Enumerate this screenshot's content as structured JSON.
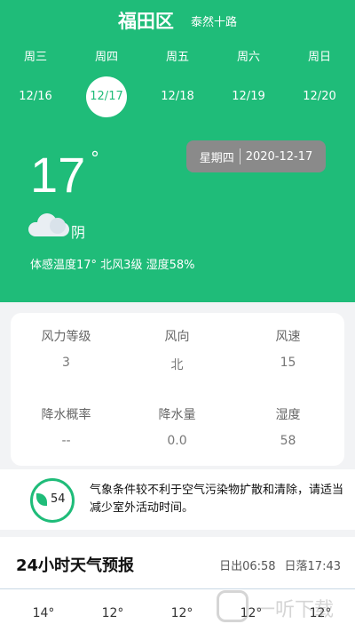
{
  "header": {
    "city": "福田区",
    "district": "泰然十路"
  },
  "days": [
    {
      "weekday": "周三",
      "date": "12/16"
    },
    {
      "weekday": "周四",
      "date": "12/17"
    },
    {
      "weekday": "周五",
      "date": "12/18"
    },
    {
      "weekday": "周六",
      "date": "12/19"
    },
    {
      "weekday": "周日",
      "date": "12/20"
    }
  ],
  "selected_day_index": 1,
  "current": {
    "weekday": "星期四",
    "date": "2020-12-17",
    "temperature": "17",
    "degree_symbol": "°",
    "condition": "阴",
    "condition_icon": "cloud-icon",
    "feels_line": "体感温度17°  北风3级  湿度58%"
  },
  "details": [
    {
      "label": "风力等级",
      "value": "3"
    },
    {
      "label": "风向",
      "value": "北"
    },
    {
      "label": "风速",
      "value": "15"
    },
    {
      "label": "降水概率",
      "value": "--"
    },
    {
      "label": "降水量",
      "value": "0.0"
    },
    {
      "label": "湿度",
      "value": "58"
    }
  ],
  "aqi": {
    "value": "54",
    "text": "气象条件较不利于空气污染物扩散和清除，请适当减少室外活动时间。",
    "color": "#1fbc79"
  },
  "forecast": {
    "title": "24小时天气预报",
    "sunrise": "日出06:58",
    "sunset": "日落17:43",
    "hours": [
      "14°",
      "12°",
      "12°",
      "12°",
      "12°"
    ]
  },
  "watermark": {
    "text": "一听下载"
  },
  "colors": {
    "accent": "#1fbc79",
    "pill": "#8a8a8a"
  }
}
